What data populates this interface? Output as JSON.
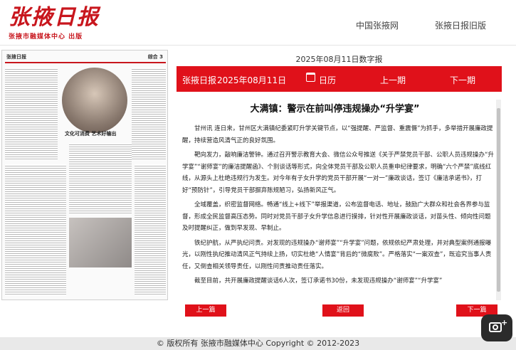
{
  "header": {
    "logo": "张掖日报",
    "logo_sub": "张掖市融媒体中心 出版",
    "nav": [
      "中国张掖网",
      "张掖日报旧版"
    ]
  },
  "paper_thumbnail": {
    "masthead": "张掖日报",
    "section": "综合 3",
    "banner": "文化可消费 艺术好输出"
  },
  "issue": {
    "title": "2025年08月11日数字报",
    "paper_name": "张掖日报",
    "date": "2025年08月11日",
    "calendar_label": "日历",
    "prev_label": "上一期",
    "next_label": "下一期"
  },
  "article": {
    "title": "大满镇：警示在前叫停违规操办“升学宴”",
    "paragraphs": [
      "甘州讯 连日来，甘州区大满镇纪委紧盯升学关键节点，以“强提醒、严监督、重震慑”为抓手，多举措开展廉政提醒，持续营造风清气正的良好氛围。",
      "靶向发力，敲响廉洁警钟。通过召开警示教育大会、微信公众号推送《关于严禁党员干部、公职人员违规操办“升学宴”“谢师宴”的廉洁提醒函》、个别谈话等形式，向全体党员干部及公职人员重申纪律要求，明确“六个严禁”底线红线，从源头上杜绝违规行为发生。对今年有子女升学的党员干部开展“一对一”廉政谈话，签订《廉洁承诺书》，打好“预防针”，引导党员干部摒弃陈规陋习，弘扬新风正气。",
      "全域覆盖，织密监督网络。畅通“线上+线下”举报渠道，公布监督电话、地址，鼓励广大群众和社会各界参与监督，形成全民监督高压态势。同时对党员干部子女升学信息进行摸排，针对性开展廉政谈话，对苗头性、倾向性问题及时提醒纠正，做到早发现、早制止。",
      "铁纪护航，从严执纪问责。对发现的违规操办“谢师宴”“升学宴”问题，依规依纪严肃处理，并对典型案例通报曝光，以刚性执纪推动清风正气持续上扬，切实杜绝“人情宴”背后的“微腐败”。严格落实“一案双查”，既追究当事人责任，又倒查相关领导责任，以刚性问责推动责任落实。",
      "截至目前，共开展廉政提醒谈话6人次，签订承诺书30份，未发现违规操办“谢师宴”“升学宴”"
    ]
  },
  "buttons": {
    "prev": "上一篇",
    "back": "返回",
    "next": "下一篇"
  },
  "footer": {
    "copyright": "© 版权所有 张掖市融媒体中心 Copyright © 2012-2023"
  },
  "colors": {
    "brand_red": "#e0111a"
  }
}
